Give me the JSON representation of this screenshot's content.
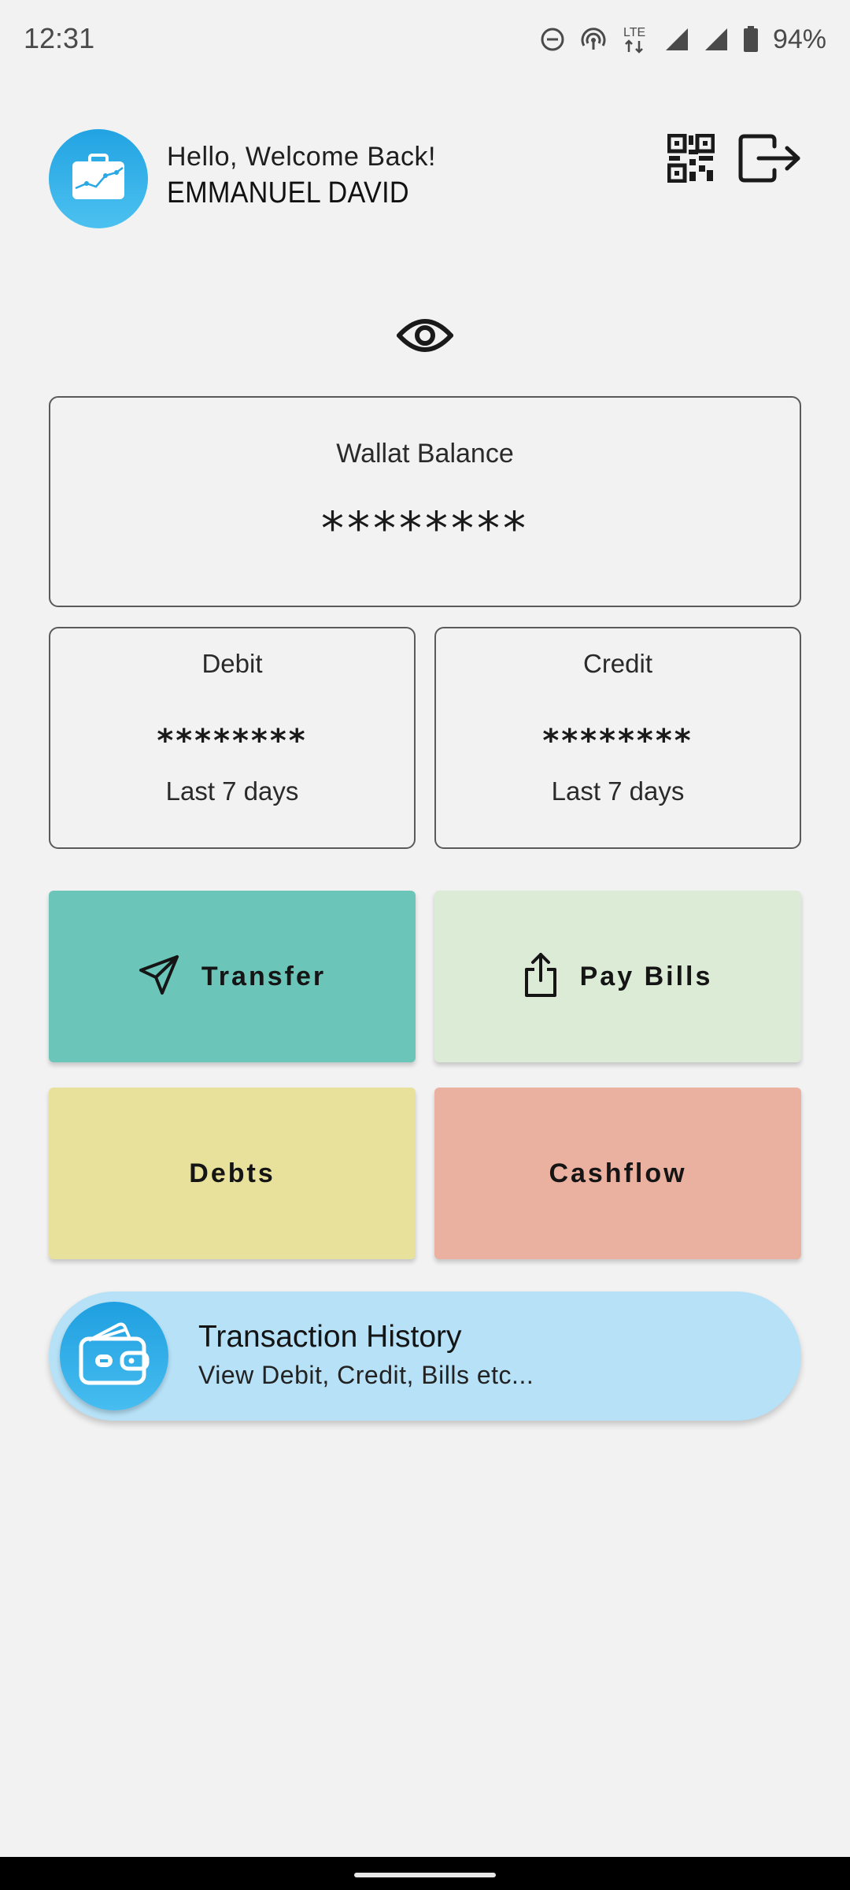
{
  "status_bar": {
    "time": "12:31",
    "network": "LTE",
    "battery": "94%"
  },
  "header": {
    "greeting": "Hello, Welcome Back!",
    "user_name": "EMMANUEL DAVID",
    "avatar_icon": "briefcase-chart-icon",
    "qr_icon": "qr-code-icon",
    "logout_icon": "logout-icon"
  },
  "visibility_toggle_icon": "eye-icon",
  "wallet": {
    "label": "Wallat Balance",
    "amount": "********"
  },
  "debit": {
    "label": "Debit",
    "amount": "********",
    "period": "Last 7 days"
  },
  "credit": {
    "label": "Credit",
    "amount": "********",
    "period": "Last 7 days"
  },
  "actions": {
    "transfer": {
      "label": "Transfer",
      "icon": "send-icon",
      "color": "#6bc6b9"
    },
    "pay_bills": {
      "label": "Pay Bills",
      "icon": "share-upload-icon",
      "color": "#dcebd6"
    },
    "debts": {
      "label": "Debts",
      "color": "#e8e19c"
    },
    "cashflow": {
      "label": "Cashflow",
      "color": "#eab1a1"
    }
  },
  "history": {
    "title": "Transaction History",
    "subtitle": "View Debit, Credit, Bills etc...",
    "icon": "wallet-icon",
    "color": "#b6e1f7"
  },
  "colors": {
    "background": "#f2f2f2",
    "accent_blue": "#22a3e2"
  }
}
